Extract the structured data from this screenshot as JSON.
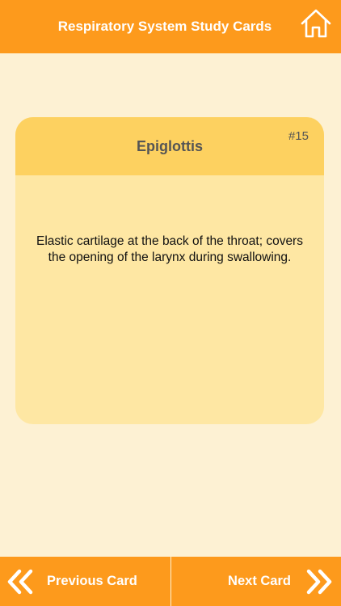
{
  "header": {
    "title": "Respiratory System Study Cards",
    "home_icon": "home-icon"
  },
  "card": {
    "term": "Epiglottis",
    "number": "#15",
    "definition": "Elastic cartilage at the back of the throat; covers the opening of the larynx during swallowing."
  },
  "footer": {
    "previous_label": "Previous Card",
    "next_label": "Next Card",
    "previous_icon": "double-chevron-left-icon",
    "next_icon": "double-chevron-right-icon"
  },
  "colors": {
    "accent": "#fd9a1c",
    "background": "#fdf1d3",
    "card_header": "#fdd160",
    "card_body": "#fee7a3"
  }
}
